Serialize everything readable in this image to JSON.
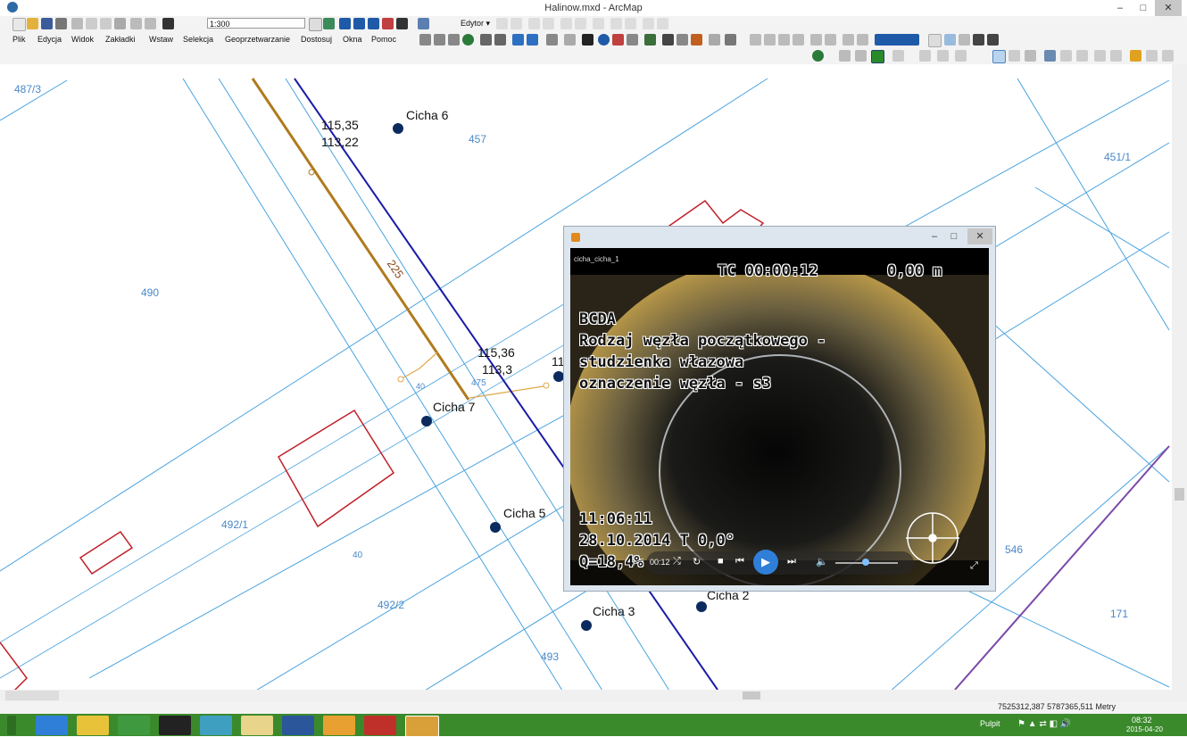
{
  "window": {
    "title": "Halinow.mxd - ArcMap",
    "min": "–",
    "max": "□",
    "close": "✕"
  },
  "toolbar": {
    "scale": "1:300",
    "editor": "Edytor ▾"
  },
  "menu": [
    "Plik",
    "Edycja",
    "Widok",
    "Zakładki",
    "Wstaw",
    "Selekcja",
    "Geoprzetwarzanie",
    "Dostosuj",
    "Okna",
    "Pomoc"
  ],
  "map": {
    "parcels": [
      "487/3",
      "490",
      "457",
      "451/1",
      "492/1",
      "492/2",
      "493",
      "546",
      "171"
    ],
    "points": [
      "Cicha 6",
      "Cicha 7",
      "Cicha 5",
      "Cicha 3",
      "Cicha 2"
    ],
    "elev_a": [
      "115,35",
      "113,22"
    ],
    "elev_b": [
      "115,36",
      "113,3"
    ],
    "pipe_label": "225",
    "small_labels": [
      "40",
      "475",
      "40",
      "11"
    ]
  },
  "video": {
    "name": "cicha_cicha_1",
    "tc": "TC 00:00:12",
    "dist": "0,00 m",
    "code": "BCDA",
    "line1": "Rodzaj węzła początkowego -",
    "line2": "studzienka włazowa",
    "line3": "oznaczenie węzła - s3",
    "time": "11:06:11",
    "date": "28.10.2014  T    0,0°",
    "q": "Q=18,4%",
    "elapsed": "00:12"
  },
  "status": {
    "coords": "7525312,387  5787365,511 Metry"
  },
  "taskbar": {
    "desktop": "Pulpit",
    "clock": "08:32",
    "date": "2015-04-20"
  },
  "colors": {
    "taskbar": "#3a8a2b",
    "parcel_line": "#4aa3df",
    "pipe_brown": "#b07a1e",
    "pipe_blue": "#1a1aa8",
    "building_red": "#c0202a",
    "point_navy": "#0b2a5e"
  }
}
